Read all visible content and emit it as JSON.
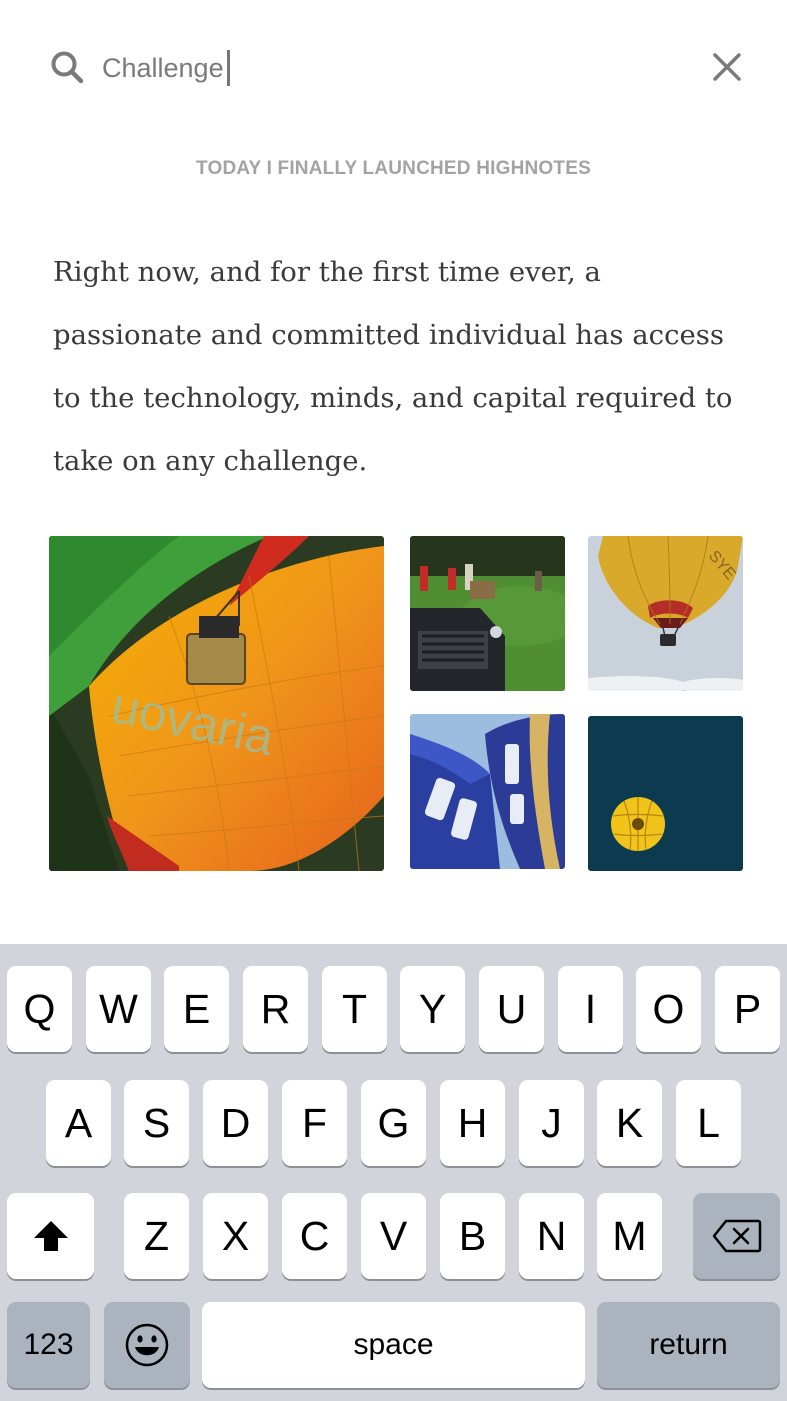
{
  "search": {
    "value": "Challenge",
    "icon": "search-icon",
    "close_icon": "close-icon"
  },
  "article": {
    "title": "TODAY I FINALLY LAUNCHED HIGHNOTES",
    "lines": [
      "Right now, and for the first time ever, a",
      "passionate and committed individual has access",
      "to the technology, minds, and capital required to",
      "take on any challenge."
    ]
  },
  "photos": [
    {
      "subject": "hot-air-balloon-basket-large"
    },
    {
      "subject": "land-rover-in-field"
    },
    {
      "subject": "balloon-in-sky"
    },
    {
      "subject": "blue-balloon-envelope"
    },
    {
      "subject": "yellow-balloon-dark-sky"
    }
  ],
  "keyboard": {
    "row1": [
      "Q",
      "W",
      "E",
      "R",
      "T",
      "Y",
      "U",
      "I",
      "O",
      "P"
    ],
    "row2": [
      "A",
      "S",
      "D",
      "F",
      "G",
      "H",
      "J",
      "K",
      "L"
    ],
    "row3": [
      "Z",
      "X",
      "C",
      "V",
      "B",
      "N",
      "M"
    ],
    "numbers_label": "123",
    "space_label": "space",
    "return_label": "return",
    "shift_icon": "shift-icon",
    "emoji_icon": "emoji-icon",
    "backspace_icon": "backspace-icon",
    "background_color": "#d1d5db",
    "special_key_color": "#abb3be"
  }
}
